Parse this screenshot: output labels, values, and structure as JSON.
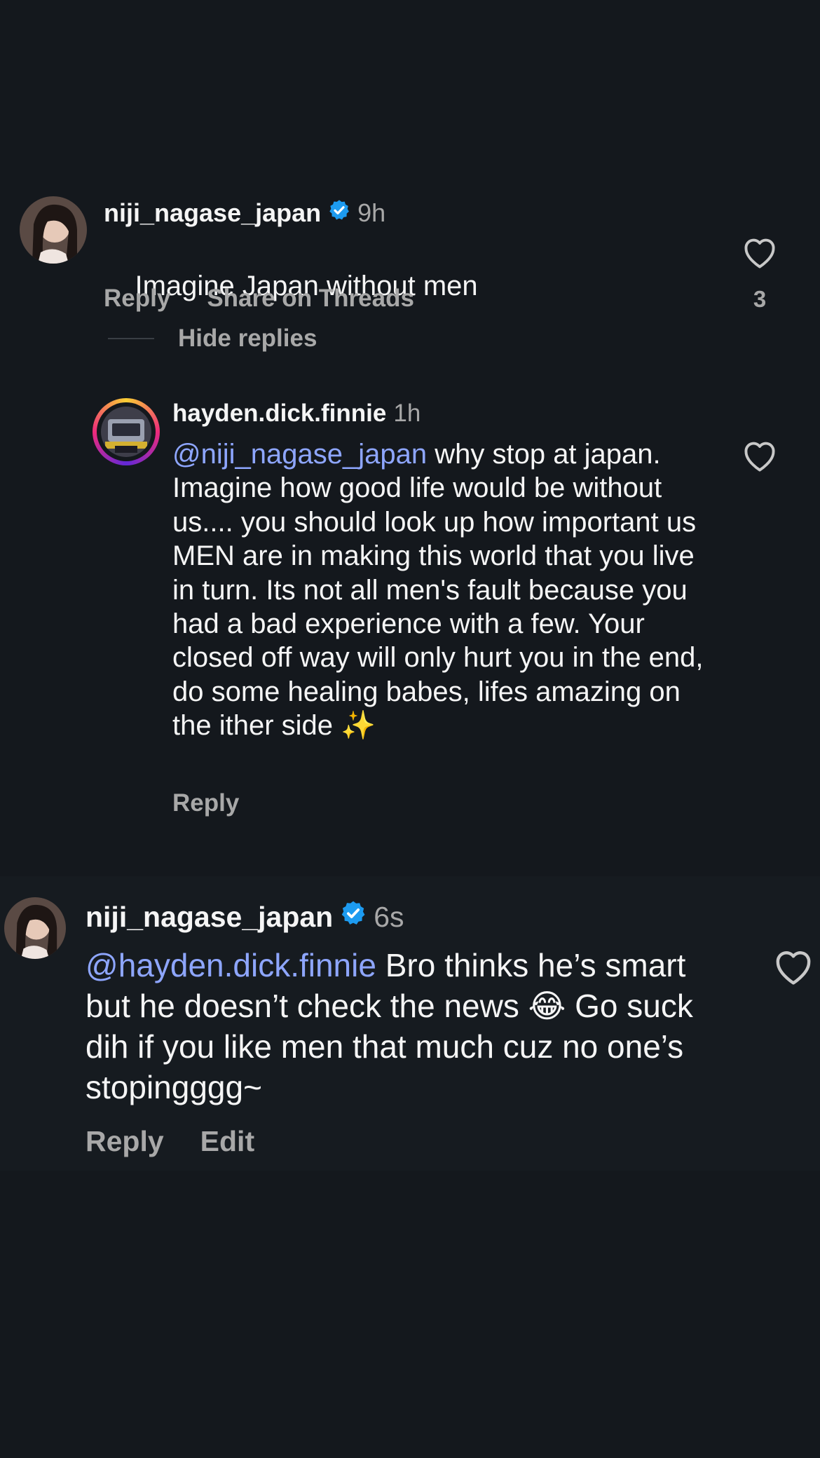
{
  "comments": [
    {
      "username": "niji_nagase_japan",
      "time": "9h",
      "text": "Imagine Japan without men",
      "reply_label": "Reply",
      "share_label": "Share on Threads",
      "likes": "3",
      "hide_replies_label": "Hide replies"
    },
    {
      "username": "hayden.dick.finnie",
      "time": "1h",
      "mention": "@niji_nagase_japan",
      "text": " why stop at japan. Imagine how good life would be without us.... you should look up how important us MEN are in making this world that you live in turn. Its not all men's fault because you had a bad experience with a few. Your closed off way will only hurt you in the end, do some healing babes, lifes amazing on the ither side ✨",
      "reply_label": "Reply"
    },
    {
      "username": "niji_nagase_japan",
      "time": "6s",
      "mention": "@hayden.dick.finnie",
      "text": " Bro thinks he’s smart but he doesn’t check the news 😂 Go suck dih if you like men that much cuz no one’s stopingggg~",
      "reply_label": "Reply",
      "edit_label": "Edit"
    }
  ],
  "icons": {
    "verified": "verified-badge-icon",
    "heart": "heart-outline-icon"
  },
  "colors": {
    "background": "#14181d",
    "text": "#f5f5f5",
    "secondary": "#a8a8a8",
    "mention": "#8ea6ff",
    "verified": "#1d9bf0"
  }
}
